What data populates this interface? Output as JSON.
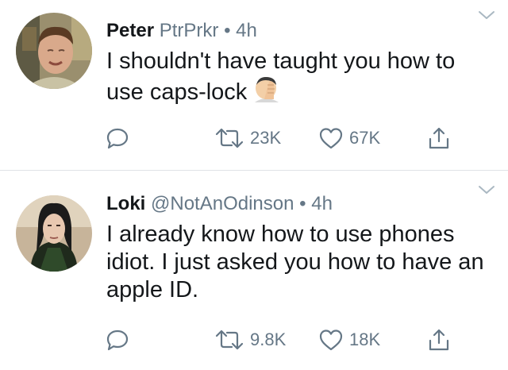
{
  "tweets": [
    {
      "name": "Peter",
      "handle": "PtrPrkr",
      "separator": "•",
      "time": "4h",
      "text": "I shouldn't have taught you how to use caps-lock",
      "emoji": "facepalm-emoji",
      "retweets": "23K",
      "likes": "67K"
    },
    {
      "name": "Loki",
      "handle": "@NotAnOdinson",
      "separator": "•",
      "time": "4h",
      "text": "I already know how to use phones idiot. I just asked you how to have an apple ID.",
      "retweets": "9.8K",
      "likes": "18K"
    }
  ],
  "colors": {
    "text": "#14171a",
    "secondary": "#657786",
    "icon": "#657786",
    "divider": "#dfe3e7"
  }
}
